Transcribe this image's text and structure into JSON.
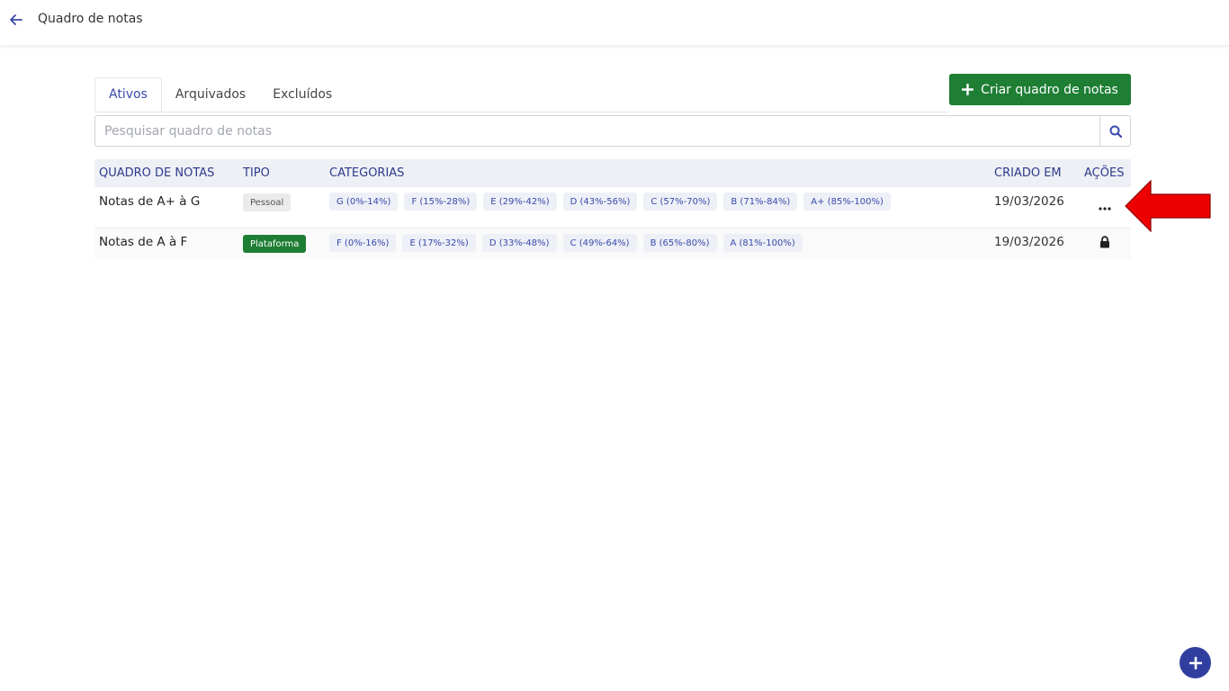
{
  "header": {
    "title": "Quadro de notas",
    "back_icon": "arrow-left-icon"
  },
  "tabs": [
    {
      "label": "Ativos",
      "active": true
    },
    {
      "label": "Arquivados",
      "active": false
    },
    {
      "label": "Excluídos",
      "active": false
    }
  ],
  "create_button": {
    "label": "Criar quadro de notas",
    "icon": "plus-icon",
    "color": "#1e7e34"
  },
  "search": {
    "placeholder": "Pesquisar quadro de notas",
    "value": "",
    "icon": "search-icon"
  },
  "table": {
    "columns": [
      "QUADRO DE NOTAS",
      "TIPO",
      "CATEGORIAS",
      "CRIADO EM",
      "AÇÕES"
    ],
    "rows": [
      {
        "name": "Notas de A+ à G",
        "type": "Pessoal",
        "categories": [
          "G (0%-14%)",
          "F (15%-28%)",
          "E (29%-42%)",
          "D (43%-56%)",
          "C (57%-70%)",
          "B (71%-84%)",
          "A+ (85%-100%)"
        ],
        "created": "19/03/2026",
        "action_icon": "more-horizontal-icon"
      },
      {
        "name": "Notas de A à F",
        "type": "Plataforma",
        "categories": [
          "F (0%-16%)",
          "E (17%-32%)",
          "D (33%-48%)",
          "C (49%-64%)",
          "B (65%-80%)",
          "A (81%-100%)"
        ],
        "created": "19/03/2026",
        "action_icon": "lock-icon"
      }
    ]
  },
  "annotation": {
    "icon": "red-arrow-pointer-icon",
    "color": "#ee0000"
  },
  "fab": {
    "icon": "plus-icon",
    "color": "#303f9f"
  }
}
